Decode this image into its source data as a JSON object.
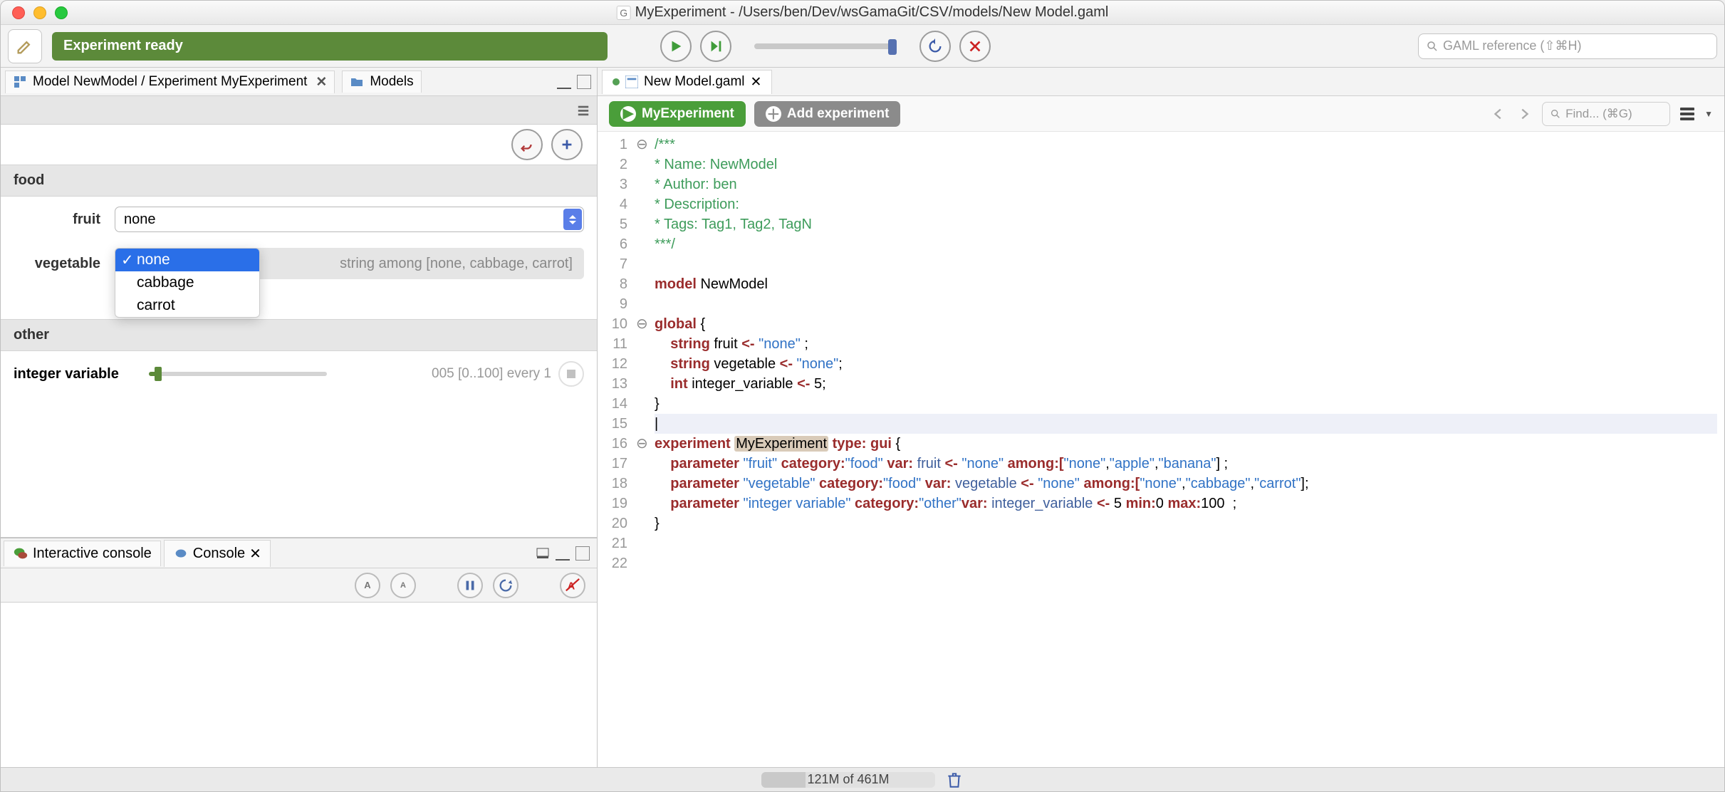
{
  "window": {
    "title": "MyExperiment - /Users/ben/Dev/wsGamaGit/CSV/models/New Model.gaml"
  },
  "toolbar": {
    "status": "Experiment ready",
    "search_placeholder": "GAML reference (⇧⌘H)"
  },
  "left_tabs": {
    "tab0": {
      "label": "Model NewModel / Experiment MyExperiment"
    },
    "tab1": {
      "label": "Models"
    }
  },
  "params": {
    "cat_food": "food",
    "fruit": {
      "label": "fruit",
      "value": "none"
    },
    "vegetable": {
      "label": "vegetable",
      "hint": "string among [none, cabbage, carrot]",
      "options": {
        "o0": "none",
        "o1": "cabbage",
        "o2": "carrot"
      }
    },
    "cat_other": "other",
    "intvar": {
      "label": "integer variable",
      "value_text": "005 [0..100] every 1"
    }
  },
  "console": {
    "tab0": "Interactive console",
    "tab1": "Console"
  },
  "editor": {
    "tab": "New Model.gaml",
    "run_btn": "MyExperiment",
    "add_btn": "Add experiment",
    "find_placeholder": "Find... (⌘G)",
    "lines": {
      "l1": "/***",
      "l2": "* Name: NewModel",
      "l3": "* Author: ben",
      "l4": "* Description:",
      "l5": "* Tags: Tag1, Tag2, TagN",
      "l6": "***/",
      "l7": "",
      "l8a": "model ",
      "l8b": "NewModel",
      "l9": "",
      "l10a": "global ",
      "l10b": "{",
      "l11a": "    string ",
      "l11b": "fruit ",
      "l11c": "<- ",
      "l11d": "\"none\"",
      "l11e": " ;",
      "l12a": "    string ",
      "l12b": "vegetable ",
      "l12c": "<- ",
      "l12d": "\"none\"",
      "l12e": ";",
      "l13a": "    int ",
      "l13b": "integer_variable ",
      "l13c": "<- ",
      "l13d": "5",
      "l13e": ";",
      "l14": "}",
      "l15": "|",
      "l16a": "experiment ",
      "l16b": "MyExperiment",
      "l16c": " type: ",
      "l16d": "gui",
      "l16e": " {",
      "l17a": "    parameter ",
      "l17b": "\"fruit\"",
      "l17c": " category:",
      "l17d": "\"food\"",
      "l17e": " var: ",
      "l17f": "fruit",
      "l17g": " <- ",
      "l17h": "\"none\"",
      "l17i": " among:[",
      "l17j": "\"none\"",
      "l17k": ",",
      "l17l": "\"apple\"",
      "l17m": ",",
      "l17n": "\"banana\"",
      "l17o": "] ;",
      "l18a": "    parameter ",
      "l18b": "\"vegetable\"",
      "l18c": " category:",
      "l18d": "\"food\"",
      "l18e": " var: ",
      "l18f": "vegetable",
      "l18g": " <- ",
      "l18h": "\"none\"",
      "l18i": " among:[",
      "l18j": "\"none\"",
      "l18k": ",",
      "l18l": "\"cabbage\"",
      "l18m": ",",
      "l18n": "\"carrot\"",
      "l18o": "];",
      "l19a": "    parameter ",
      "l19b": "\"integer variable\"",
      "l19c": " category:",
      "l19d": "\"other\"",
      "l19e": "var: ",
      "l19f": "integer_variable",
      "l19g": " <- ",
      "l19h": "5",
      "l19i": " min:",
      "l19j": "0",
      "l19k": " max:",
      "l19l": "100",
      "l19m": "  ;",
      "l20": "}",
      "l21": "",
      "l22": ""
    }
  },
  "statusbar": {
    "memory": "121M of 461M"
  }
}
